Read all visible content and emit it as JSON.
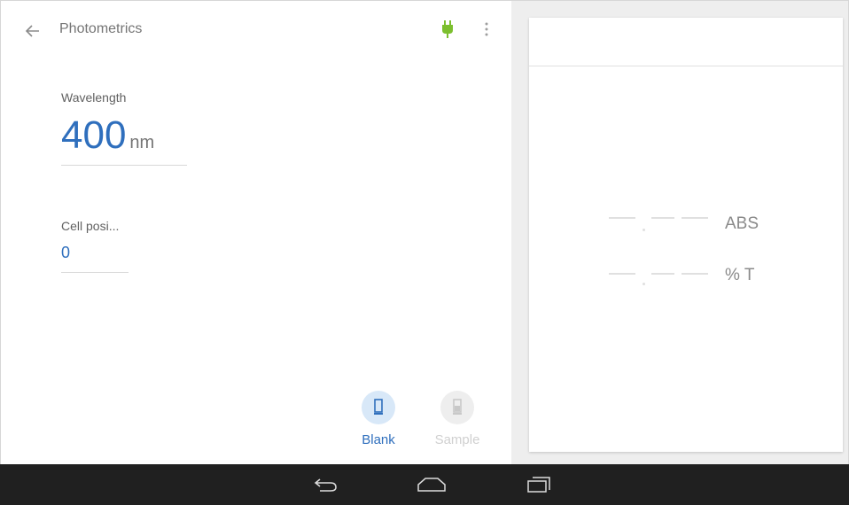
{
  "app": {
    "title": "Photometrics",
    "plug_icon_color": "#7cbf2e"
  },
  "wavelength": {
    "label": "Wavelength",
    "value": "400",
    "unit": "nm"
  },
  "cell_position": {
    "label": "Cell posi...",
    "value": "0"
  },
  "modes": {
    "blank_label": "Blank",
    "sample_label": "Sample",
    "active_color": "#2f6fbd"
  },
  "readings": {
    "abs_value": "—.——",
    "abs_unit": "ABS",
    "t_value": "—.——",
    "t_unit": "% T"
  },
  "icons": {
    "back": "arrow-left-icon",
    "plug": "plug-icon",
    "overflow": "more-vert-icon",
    "blank": "cuvette-icon",
    "sample": "cuvette-filled-icon",
    "nav_back": "nav-back-icon",
    "nav_home": "nav-home-icon",
    "nav_recents": "nav-recents-icon"
  }
}
